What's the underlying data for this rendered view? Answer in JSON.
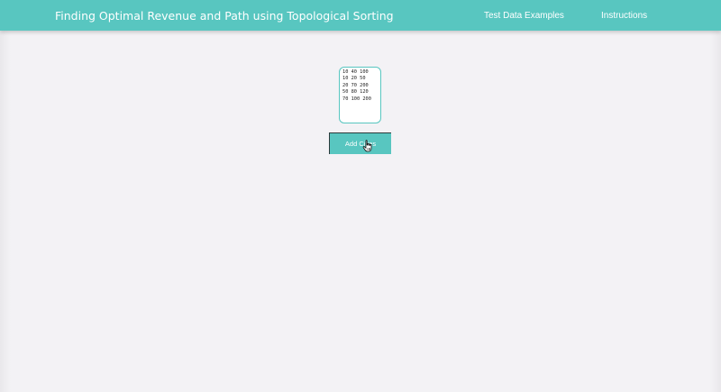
{
  "colors": {
    "accent": "#58c6c0",
    "background": "#f3f2f5"
  },
  "navbar": {
    "title": "Finding Optimal Revenue and Path using Topological Sorting",
    "links": [
      {
        "label": "Test Data Examples"
      },
      {
        "label": "Instructions"
      }
    ]
  },
  "main": {
    "cities_input": {
      "value": "10 40 100\n10 20 50\n20 70 200\n50 80 120\n70 100 200"
    },
    "add_button": {
      "label": "Add Cities"
    }
  },
  "cursor": {
    "icon": "hand-pointer-icon"
  }
}
